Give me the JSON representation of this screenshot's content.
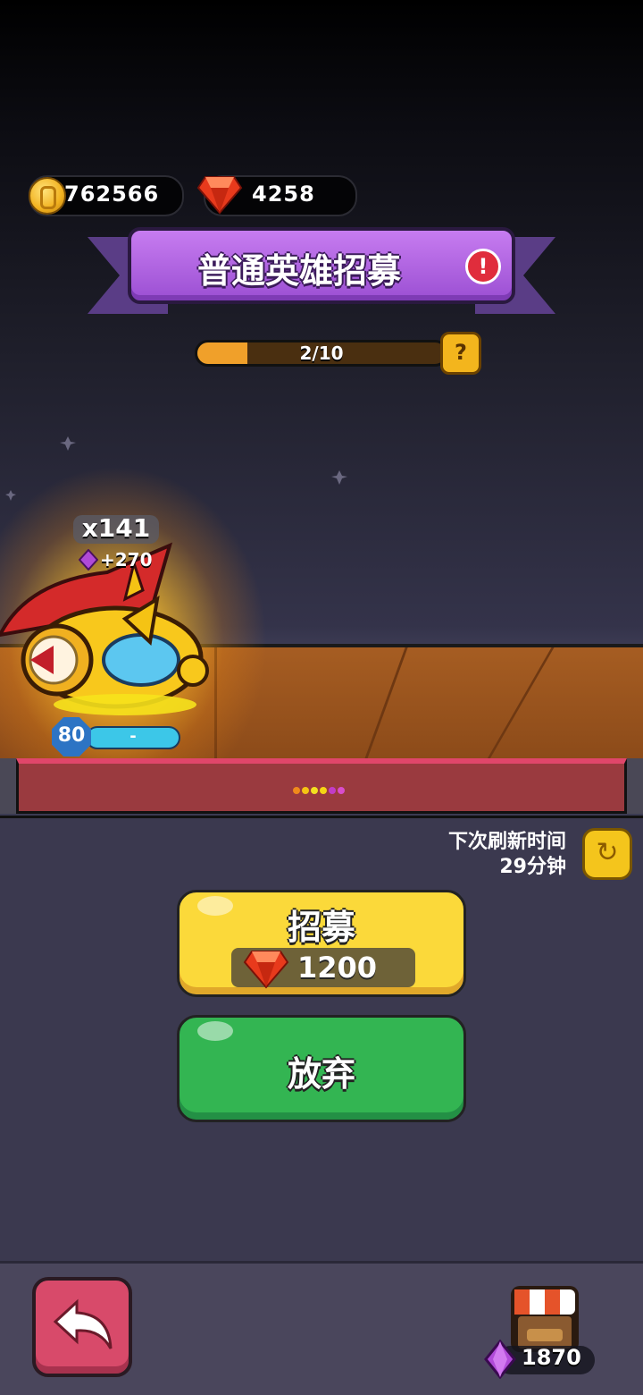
{
  "currency": {
    "gold": "762566",
    "ruby": "4258"
  },
  "banner": {
    "title": "普通英雄招募",
    "alert_icon": "!"
  },
  "progress": {
    "text": "2/10",
    "fraction": 0.2,
    "help_icon": "?"
  },
  "hero": {
    "count": "x141",
    "bonus": "+270",
    "level": "80",
    "xp_label": "-"
  },
  "rarity_dots": [
    "#f08a1c",
    "#f5c314",
    "#f3e020",
    "#f5d514",
    "#c23cc7",
    "#d94dcc"
  ],
  "refresh": {
    "line1": "下次刷新时间",
    "line2": "29分钟",
    "icon": "refresh-icon"
  },
  "buttons": {
    "recruit_label": "招募",
    "recruit_cost": "1200",
    "abandon_label": "放弃"
  },
  "shop": {
    "gem_count": "1870"
  },
  "colors": {
    "banner_purple": "#b86ae8",
    "recruit_yellow": "#fbd93a",
    "abandon_green": "#33b552",
    "back_pink": "#d84a6a"
  }
}
